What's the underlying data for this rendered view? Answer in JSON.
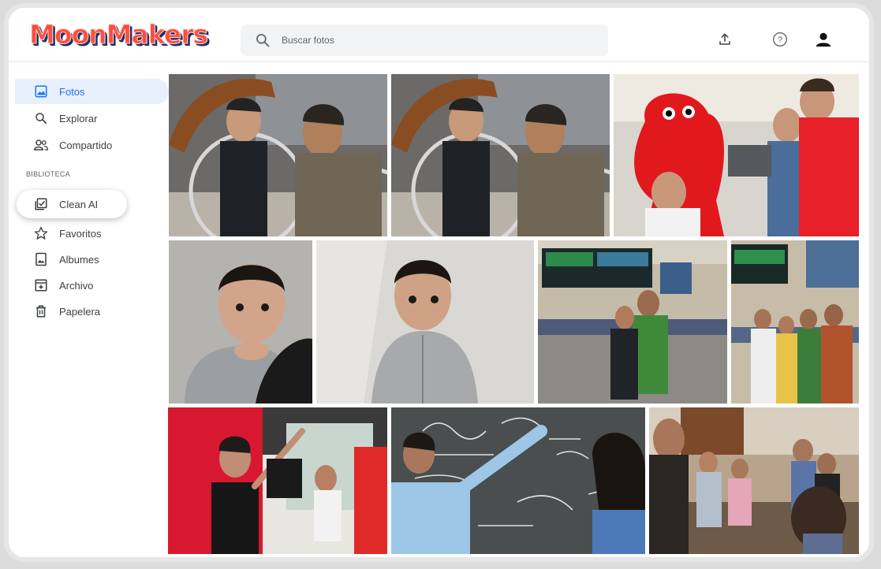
{
  "header": {
    "logo_text": "MoonMakers",
    "search_placeholder": "Buscar fotos"
  },
  "sidebar": {
    "items": [
      {
        "label": "Fotos",
        "icon": "photo-icon",
        "active": true
      },
      {
        "label": "Explorar",
        "icon": "search-icon"
      },
      {
        "label": "Compartido",
        "icon": "people-icon"
      }
    ],
    "section_label": "BIBLIOTECA",
    "library": [
      {
        "label": "Clean AI",
        "icon": "checked-photos-icon",
        "highlighted": true
      },
      {
        "label": "Favoritos",
        "icon": "star-icon"
      },
      {
        "label": "Albumes",
        "icon": "album-icon"
      },
      {
        "label": "Archivo",
        "icon": "archive-icon"
      },
      {
        "label": "Papelera",
        "icon": "trash-icon"
      }
    ]
  },
  "photos": [
    {
      "name": "photo-bike-repair-1",
      "subject": "bike-repair"
    },
    {
      "name": "photo-bike-repair-2",
      "subject": "bike-repair"
    },
    {
      "name": "photo-mascot-group",
      "subject": "mascot"
    },
    {
      "name": "photo-baby-1",
      "subject": "baby"
    },
    {
      "name": "photo-baby-2",
      "subject": "baby"
    },
    {
      "name": "photo-control-room-1",
      "subject": "control-room"
    },
    {
      "name": "photo-control-room-2",
      "subject": "control-room"
    },
    {
      "name": "photo-event-speakers",
      "subject": "event"
    },
    {
      "name": "photo-chalkboard",
      "subject": "chalkboard"
    },
    {
      "name": "photo-workshop",
      "subject": "workshop"
    }
  ],
  "colors": {
    "accent": "#1a73e8",
    "active_bg": "#e8f0fe",
    "logo_red": "#ff4d3d",
    "logo_navy": "#1f2f6b"
  }
}
